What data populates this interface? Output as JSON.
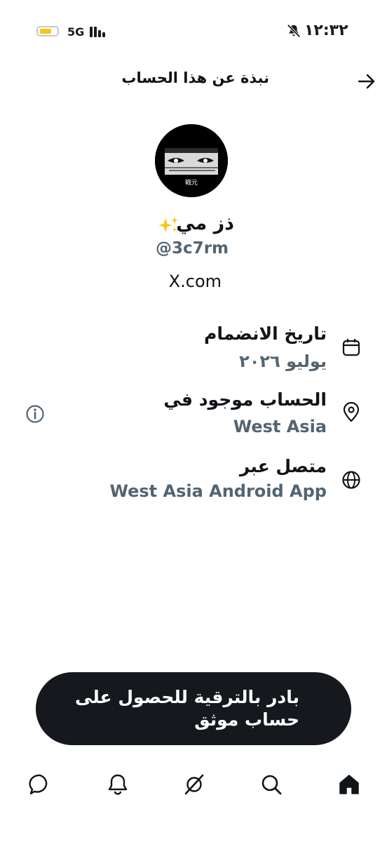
{
  "status_bar": {
    "network": "5G",
    "time": "١٢:٣٢",
    "battery_level": 0.55,
    "icons": [
      "battery-icon",
      "signal-icon",
      "mute-icon"
    ]
  },
  "header": {
    "title": "نبذة عن هذا الحساب",
    "back_icon": "arrow-right-icon"
  },
  "profile": {
    "display_name": "ذز مي",
    "display_name_icon": "sparkles-icon",
    "handle": "@3c7rm",
    "website": "X.com",
    "avatar_icon": "avatar-image"
  },
  "info_rows": [
    {
      "icon": "calendar-icon",
      "title": "تاريخ الانضمام",
      "value": "يوليو ٢٠٢٦"
    },
    {
      "icon": "location-pin-icon",
      "title": "الحساب موجود في",
      "value": "West Asia"
    },
    {
      "icon": "globe-icon",
      "title": "متصل عبر",
      "value": "West Asia Android App"
    }
  ],
  "upgrade": {
    "line1": "بادر بالترقية للحصول على",
    "line2": "حساب موثق"
  },
  "bottom_nav": [
    "messages-icon",
    "notifications-icon",
    "grok-icon",
    "search-icon",
    "home-icon"
  ],
  "colors": {
    "text_primary": "#0f1419",
    "text_secondary": "#536471",
    "button_bg": "#15181c",
    "battery_fill": "#f5c518"
  }
}
